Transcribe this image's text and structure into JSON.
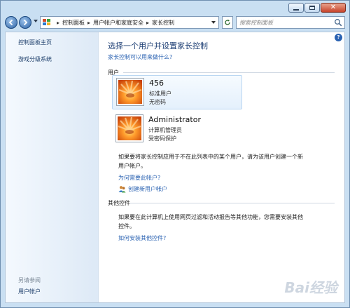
{
  "window": {
    "caption": {
      "minimize": "",
      "maximize": "",
      "close": "✕"
    }
  },
  "nav": {
    "breadcrumbs": [
      "控制面板",
      "用户帐户和家庭安全",
      "家长控制"
    ],
    "search_placeholder": "搜索控制面板"
  },
  "help": {
    "label": "?"
  },
  "sidebar": {
    "links": [
      "控制面板主页",
      "游戏分级系统"
    ],
    "see_also_title": "另请参阅",
    "see_also_links": [
      "用户帐户"
    ]
  },
  "main": {
    "title": "选择一个用户并设置家长控制",
    "help_link": "家长控制可以用来做什么?",
    "users_section": "用户",
    "users": [
      {
        "name": "456",
        "type": "标准用户",
        "password": "无密码"
      },
      {
        "name": "Administrator",
        "type": "计算机管理员",
        "password": "受密码保护"
      }
    ],
    "not_listed_text": "如果要将家长控制应用于不在此列表中的某个用户，请为该用户创建一个新用户帐户。",
    "why_link": "为何需要此帐户?",
    "create_link": "创建新用户帐户",
    "other_section": "其他控件",
    "other_text": "如果要在此计算机上使用网页过滤和活动报告等其他功能，您需要安装其他控件。",
    "install_link": "如何安装其他控件?"
  },
  "watermark": "Bai经验",
  "colors": {
    "accent": "#2a62b2",
    "title": "#1e3f74",
    "sidebar_bg": "#dde9f6",
    "frame": "#c9dff2"
  }
}
